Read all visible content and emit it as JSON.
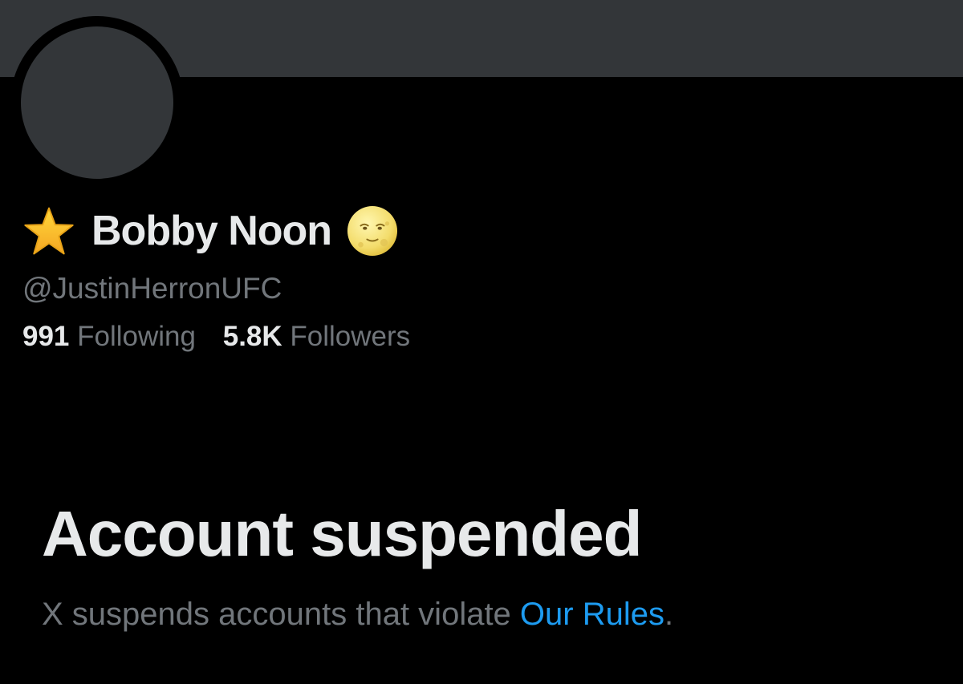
{
  "colors": {
    "background": "#000000",
    "banner": "#333639",
    "primary_text": "#e7e9ea",
    "secondary_text": "#71767b",
    "link": "#1d9bf0"
  },
  "profile": {
    "name_prefix_icon": "star-icon",
    "display_name": "Bobby Noon",
    "name_suffix_icon": "full-moon-face-icon",
    "handle": "@JustinHerronUFC",
    "following_count": "991",
    "following_label": "Following",
    "followers_count": "5.8K",
    "followers_label": "Followers"
  },
  "suspension": {
    "title": "Account suspended",
    "message_prefix": "X suspends accounts that violate ",
    "link_text": "Our Rules",
    "message_suffix": "."
  }
}
